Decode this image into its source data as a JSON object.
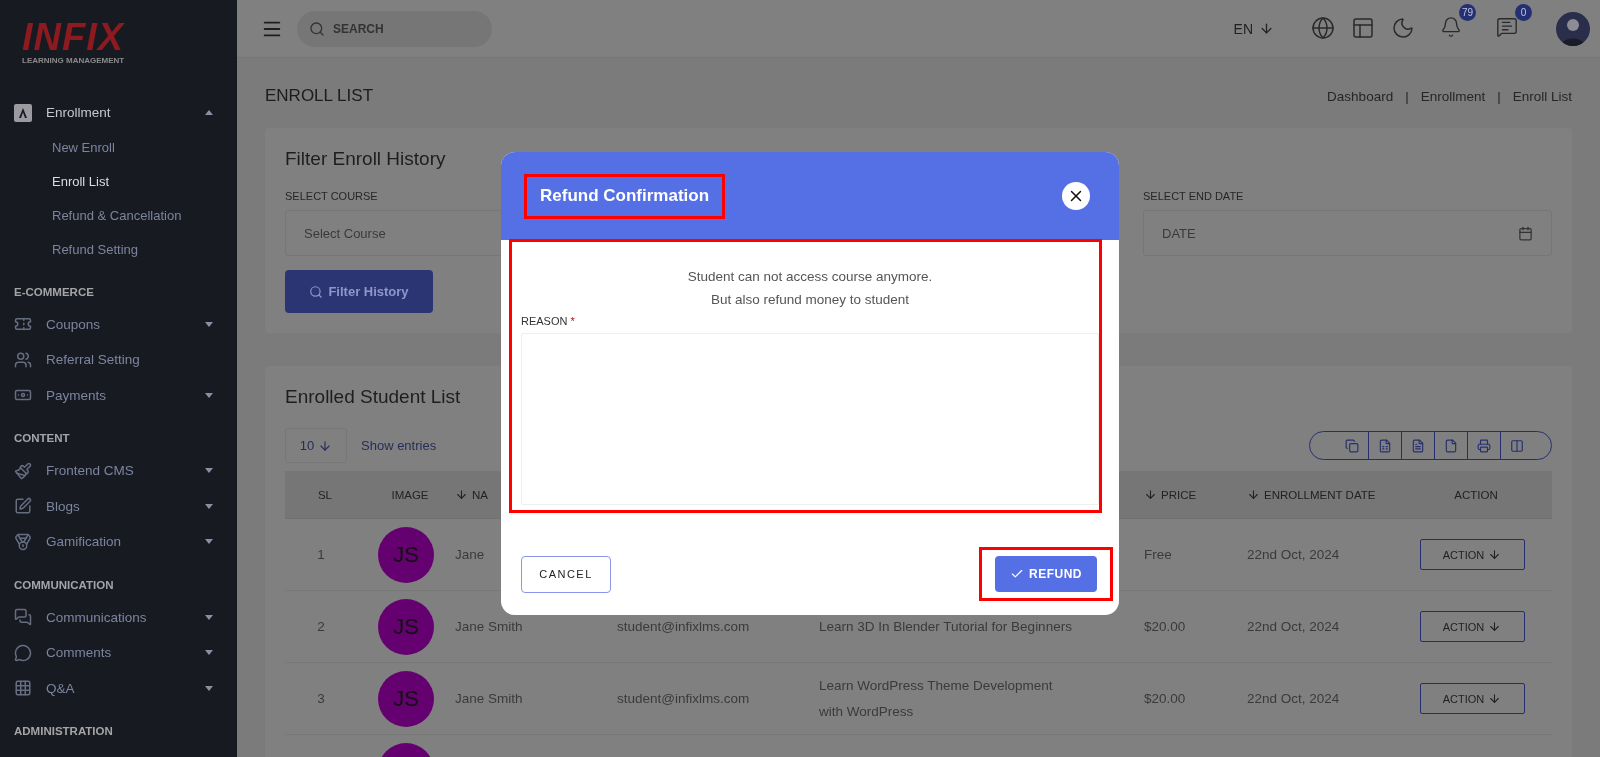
{
  "logo": {
    "name": "INFIX",
    "tagline": "LEARNING MANAGEMENT"
  },
  "sidebar": {
    "groups": [
      {
        "items": [
          {
            "label": "Enrollment",
            "expanded": true,
            "children": [
              {
                "label": "New Enroll",
                "selected": false
              },
              {
                "label": "Enroll List",
                "selected": true
              },
              {
                "label": "Refund & Cancellation",
                "selected": false
              },
              {
                "label": "Refund Setting",
                "selected": false
              }
            ]
          }
        ]
      },
      {
        "heading": "E-COMMERCE",
        "items": [
          {
            "label": "Coupons",
            "expanded": false
          },
          {
            "label": "Referral Setting"
          },
          {
            "label": "Payments",
            "expanded": false
          }
        ]
      },
      {
        "heading": "CONTENT",
        "items": [
          {
            "label": "Frontend CMS",
            "expanded": false
          },
          {
            "label": "Blogs",
            "expanded": false
          },
          {
            "label": "Gamification",
            "expanded": false
          }
        ]
      },
      {
        "heading": "COMMUNICATION",
        "items": [
          {
            "label": "Communications",
            "expanded": false
          },
          {
            "label": "Comments",
            "expanded": false
          },
          {
            "label": "Q&A",
            "expanded": false
          }
        ]
      },
      {
        "heading": "ADMINISTRATION"
      }
    ]
  },
  "header": {
    "search": {
      "placeholder": "SEARCH"
    },
    "language": "EN",
    "notifications": "79",
    "messages": "0"
  },
  "page": {
    "title": "ENROLL LIST",
    "breadcrumbs": [
      "Dashboard",
      "Enrollment",
      "Enroll List"
    ],
    "separator": "|"
  },
  "filter": {
    "title": "Filter Enroll History",
    "fields": [
      {
        "label": "SELECT COURSE",
        "placeholder": "Select Course",
        "kind": "select"
      },
      {
        "label": "SELECT END DATE",
        "placeholder": "DATE",
        "kind": "date"
      }
    ],
    "button": "Filter History"
  },
  "students": {
    "title": "Enrolled Student List",
    "per_page": "10",
    "per_page_label": "Show entries",
    "columns": [
      {
        "label": "SL",
        "sortable": false
      },
      {
        "label": "IMAGE",
        "sortable": false
      },
      {
        "label": "NA",
        "sortable": true
      },
      {
        "label": "PRICE",
        "sortable": true
      },
      {
        "label": "ENROLLMENT DATE",
        "sortable": true
      },
      {
        "label": "ACTION",
        "sortable": false
      }
    ],
    "rows": [
      {
        "sl": "1",
        "initials": "JS",
        "name": "Jane",
        "price": "Free",
        "date": "22nd Oct, 2024",
        "action": "ACTION"
      },
      {
        "sl": "2",
        "initials": "JS",
        "name": "Jane Smith",
        "email": "student@infixlms.com",
        "course": [
          "Learn 3D In Blender Tutorial for Beginners"
        ],
        "price": "$20.00",
        "date": "22nd Oct, 2024",
        "action": "ACTION"
      },
      {
        "sl": "3",
        "initials": "JS",
        "name": "Jane Smith",
        "email": "student@infixlms.com",
        "course": [
          "Learn WordPress Theme Development",
          "with WordPress"
        ],
        "price": "$20.00",
        "date": "22nd Oct, 2024",
        "action": "ACTION"
      },
      {
        "cut_off": true
      }
    ]
  },
  "modal": {
    "title": "Refund Confirmation",
    "title_highlighted": true,
    "body_highlighted": true,
    "message": [
      "Student can not access course anymore.",
      "But also refund money to student"
    ],
    "reason_label": "REASON",
    "required_mark": "*",
    "cancel": "CANCEL",
    "confirm": {
      "label": "REFUND",
      "highlighted": true
    }
  }
}
